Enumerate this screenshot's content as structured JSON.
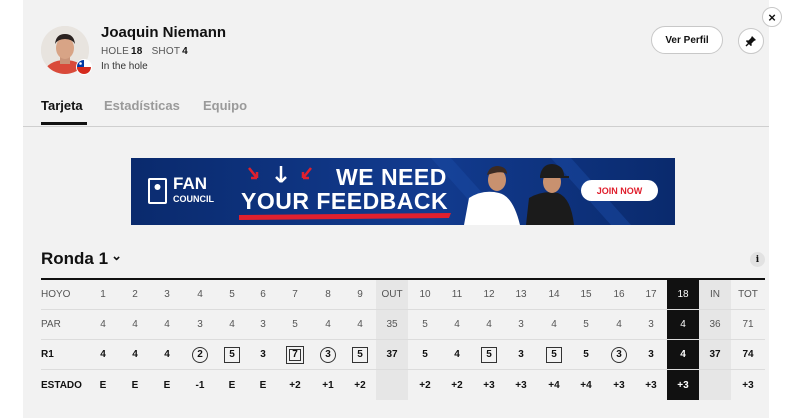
{
  "player": {
    "name": "Joaquin Niemann",
    "hole_label": "HOLE",
    "hole_value": "18",
    "shot_label": "SHOT",
    "shot_value": "4",
    "status": "In the hole",
    "avatar_icon": "player-headshot",
    "flag_icon": "chile-flag-icon"
  },
  "actions": {
    "profile_label": "Ver Perfil",
    "pin_icon": "pin-icon",
    "close_icon": "close-icon",
    "close_glyph": "×"
  },
  "tabs": [
    {
      "label": "Tarjeta",
      "active": true
    },
    {
      "label": "Estadísticas",
      "active": false
    },
    {
      "label": "Equipo",
      "active": false
    }
  ],
  "banner": {
    "logo_line1": "FAN",
    "logo_line2": "COUNCIL",
    "headline_line1": "WE NEED",
    "headline_line2": "YOUR FEEDBACK",
    "cta_label": "JOIN NOW",
    "colors": {
      "navy": "#0c2d73",
      "red": "#e0202e",
      "white": "#ffffff"
    }
  },
  "round": {
    "title": "Ronda 1",
    "chevron_glyph": "⌄",
    "info_glyph": "i"
  },
  "scorecard": {
    "row_labels": {
      "hole": "HOYO",
      "par": "PAR",
      "round": "R1",
      "status": "ESTADO"
    },
    "columns": [
      {
        "hole": "1",
        "par": "4",
        "score": "4",
        "status": "E",
        "mark": "none"
      },
      {
        "hole": "2",
        "par": "4",
        "score": "4",
        "status": "E",
        "mark": "none"
      },
      {
        "hole": "3",
        "par": "4",
        "score": "4",
        "status": "E",
        "mark": "none"
      },
      {
        "hole": "4",
        "par": "3",
        "score": "2",
        "status": "-1",
        "mark": "circle"
      },
      {
        "hole": "5",
        "par": "4",
        "score": "5",
        "status": "E",
        "mark": "square"
      },
      {
        "hole": "6",
        "par": "3",
        "score": "3",
        "status": "E",
        "mark": "none"
      },
      {
        "hole": "7",
        "par": "5",
        "score": "7",
        "status": "+2",
        "mark": "double-square"
      },
      {
        "hole": "8",
        "par": "4",
        "score": "3",
        "status": "+1",
        "mark": "circle"
      },
      {
        "hole": "9",
        "par": "4",
        "score": "5",
        "status": "+2",
        "mark": "square"
      },
      {
        "hole": "OUT",
        "par": "35",
        "score": "37",
        "status": "",
        "mark": "none",
        "total": true
      },
      {
        "hole": "10",
        "par": "5",
        "score": "5",
        "status": "+2",
        "mark": "none"
      },
      {
        "hole": "11",
        "par": "4",
        "score": "4",
        "status": "+2",
        "mark": "none"
      },
      {
        "hole": "12",
        "par": "4",
        "score": "5",
        "status": "+3",
        "mark": "square"
      },
      {
        "hole": "13",
        "par": "3",
        "score": "3",
        "status": "+3",
        "mark": "none"
      },
      {
        "hole": "14",
        "par": "4",
        "score": "5",
        "status": "+4",
        "mark": "square"
      },
      {
        "hole": "15",
        "par": "5",
        "score": "5",
        "status": "+4",
        "mark": "none"
      },
      {
        "hole": "16",
        "par": "4",
        "score": "3",
        "status": "+3",
        "mark": "circle"
      },
      {
        "hole": "17",
        "par": "3",
        "score": "3",
        "status": "+3",
        "mark": "none"
      },
      {
        "hole": "18",
        "par": "4",
        "score": "4",
        "status": "+3",
        "mark": "none",
        "current": true
      },
      {
        "hole": "IN",
        "par": "36",
        "score": "37",
        "status": "",
        "mark": "none",
        "total": true
      },
      {
        "hole": "TOT",
        "par": "71",
        "score": "74",
        "status": "+3",
        "mark": "none"
      }
    ]
  }
}
